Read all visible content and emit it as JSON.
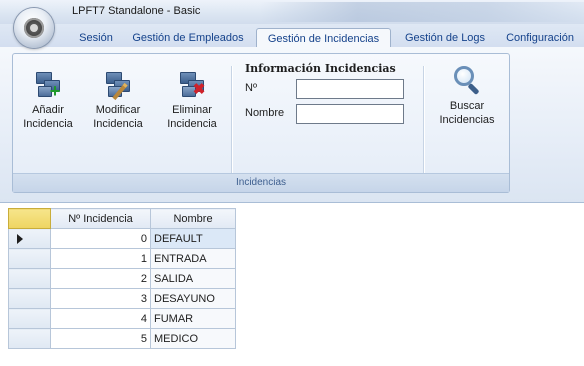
{
  "window": {
    "title": "LPFT7 Standalone - Basic"
  },
  "tabs": [
    {
      "label": "Sesión",
      "active": false
    },
    {
      "label": "Gestión de Empleados",
      "active": false
    },
    {
      "label": "Gestión de Incidencias",
      "active": true
    },
    {
      "label": "Gestión de Logs",
      "active": false
    },
    {
      "label": "Configuración",
      "active": false
    }
  ],
  "ribbon": {
    "group_caption": "Incidencias",
    "buttons": {
      "add": {
        "line1": "Añadir",
        "line2": "Incidencia",
        "icon": "monitors-add-icon"
      },
      "modify": {
        "line1": "Modificar",
        "line2": "Incidencia",
        "icon": "monitors-edit-icon"
      },
      "delete": {
        "line1": "Eliminar",
        "line2": "Incidencia",
        "icon": "monitors-delete-icon"
      },
      "search": {
        "line1": "Buscar",
        "line2": "Incidencias",
        "icon": "magnifier-icon"
      }
    },
    "info_form": {
      "title": "Información Incidencias",
      "number_label": "Nº",
      "number_value": "",
      "name_label": "Nombre",
      "name_value": ""
    }
  },
  "grid": {
    "columns": [
      "Nº Incidencia",
      "Nombre"
    ],
    "rows": [
      {
        "number": "0",
        "name": "DEFAULT",
        "selected": true
      },
      {
        "number": "1",
        "name": "ENTRADA",
        "selected": false
      },
      {
        "number": "2",
        "name": "SALIDA",
        "selected": false
      },
      {
        "number": "3",
        "name": "DESAYUNO",
        "selected": false
      },
      {
        "number": "4",
        "name": "FUMAR",
        "selected": false
      },
      {
        "number": "5",
        "name": "MEDICO",
        "selected": false
      }
    ]
  },
  "colors": {
    "tab_text": "#15428b",
    "ribbon_border": "#a9bdd6",
    "corner_highlight": "#eed461"
  }
}
